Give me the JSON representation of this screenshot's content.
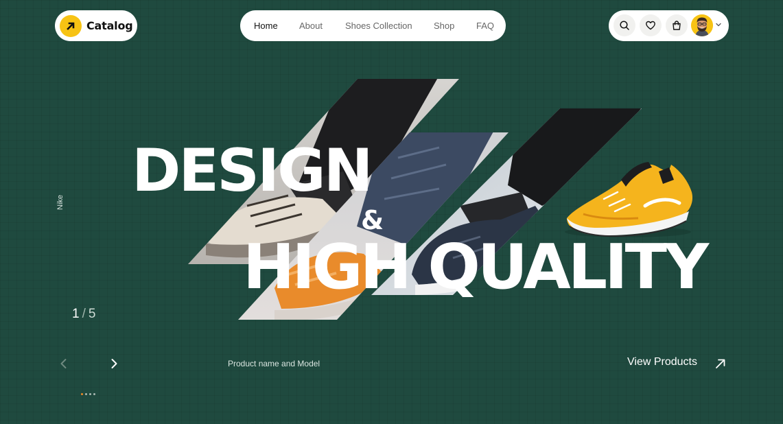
{
  "brand": {
    "name": "Catalog",
    "accent": "#f7c314",
    "logo_icon": "arrow-up-right-icon"
  },
  "nav": {
    "items": [
      {
        "label": "Home",
        "active": true
      },
      {
        "label": "About",
        "active": false
      },
      {
        "label": "Shoes Collection",
        "active": false
      },
      {
        "label": "Shop",
        "active": false
      },
      {
        "label": "FAQ",
        "active": false
      }
    ]
  },
  "actions": {
    "icons": [
      "search-icon",
      "heart-icon",
      "shopping-bag-icon"
    ],
    "avatar": "user-avatar",
    "menu_icon": "chevron-down-icon"
  },
  "hero": {
    "line1": "DESIGN",
    "amp": "&",
    "line2": "HIGH QUALITY",
    "side_label": "Nike",
    "slide_current": "1",
    "slide_separator": "/",
    "slide_total": "5",
    "product_name": "Product name and Model",
    "cta_label": "View Products",
    "dots": {
      "count": 4,
      "active_index": 0
    }
  },
  "colors": {
    "background": "#1f4a3f",
    "accent": "#f7c314",
    "dot_active": "#f08a24"
  }
}
